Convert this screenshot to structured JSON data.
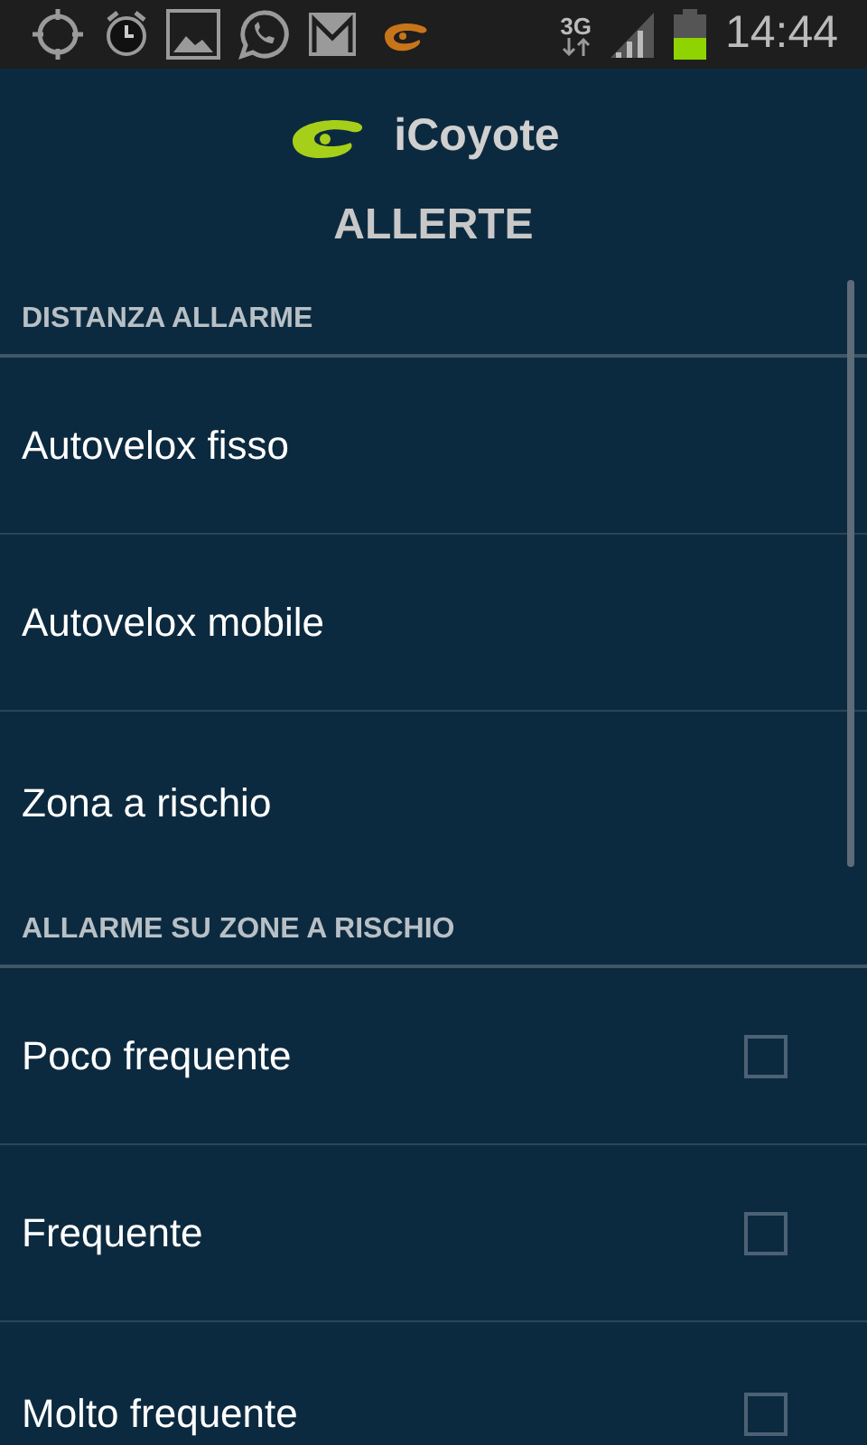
{
  "status_bar": {
    "network": "3G",
    "time": "14:44"
  },
  "header": {
    "app_name": "iCoyote",
    "title": "ALLERTE"
  },
  "sections": [
    {
      "title": "DISTANZA ALLARME",
      "items": [
        {
          "label": "Autovelox fisso",
          "kind": "plain"
        },
        {
          "label": "Autovelox mobile",
          "kind": "plain"
        },
        {
          "label": "Zona a rischio",
          "kind": "plain"
        }
      ]
    },
    {
      "title": "ALLARME SU ZONE A RISCHIO",
      "items": [
        {
          "label": "Poco frequente",
          "kind": "checkbox",
          "checked": false
        },
        {
          "label": "Frequente",
          "kind": "checkbox",
          "checked": false
        },
        {
          "label": "Molto frequente",
          "kind": "checkbox",
          "checked": false
        }
      ]
    }
  ]
}
